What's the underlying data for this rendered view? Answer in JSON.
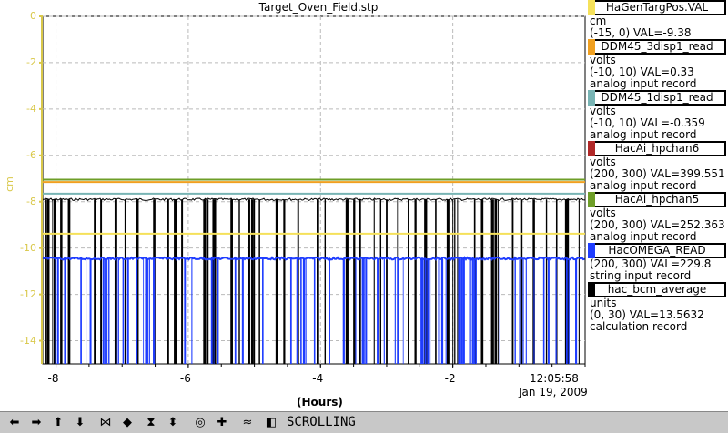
{
  "title": "Target_Oven_Field.stp",
  "axes": {
    "y_label": "cm",
    "y_ticks": [
      "0",
      "-2",
      "-4",
      "-6",
      "-8",
      "-10",
      "-12",
      "-14"
    ],
    "x_ticks": [
      "-8",
      "-6",
      "-4",
      "-2"
    ],
    "x_unit": "(Hours)",
    "time": "12:05:58",
    "date": "Jan 19, 2009"
  },
  "legend": [
    {
      "name": "HaGenTargPos.VAL",
      "color": "#f5e15a",
      "unit": "cm",
      "range_val": "(-15, 0) VAL=-9.38",
      "record": ""
    },
    {
      "name": "DDM45_3disp1_read",
      "color": "#f0a020",
      "unit": "volts",
      "range_val": "(-10, 10) VAL=0.33",
      "record": "analog input record"
    },
    {
      "name": "DDM45_1disp1_read",
      "color": "#78b4b4",
      "unit": "volts",
      "range_val": "(-10, 10) VAL=-0.359",
      "record": "analog input record"
    },
    {
      "name": "HacAi_hpchan6",
      "color": "#b02828",
      "unit": "volts",
      "range_val": "(200, 300) VAL=399.551",
      "record": "analog input record"
    },
    {
      "name": "HacAi_hpchan5",
      "color": "#6e9e28",
      "unit": "volts",
      "range_val": "(200, 300) VAL=252.363",
      "record": "analog input record"
    },
    {
      "name": "HacOMEGA_READ",
      "color": "#1e3cff",
      "unit": "",
      "range_val": "(200, 300) VAL=229.8",
      "record": "string input record"
    },
    {
      "name": "hac_bcm_average",
      "color": "#000000",
      "unit": "units",
      "range_val": "(0, 30) VAL=13.5632",
      "record": "calculation record"
    }
  ],
  "toolbar": {
    "mode_label": "SCROLLING",
    "buttons": [
      "scroll-left-icon",
      "scroll-right-icon",
      "scroll-up-icon",
      "scroll-down-icon",
      "zoom-in-x-icon",
      "zoom-out-x-icon",
      "zoom-in-y-icon",
      "zoom-out-y-icon",
      "autoscale-icon",
      "marker-icon",
      "stagger-icon",
      "export-icon"
    ]
  },
  "chart_data": {
    "type": "line",
    "title": "Target_Oven_Field.stp",
    "xlabel": "(Hours)",
    "ylabel": "cm",
    "xlim": [
      -8.2,
      0
    ],
    "ylim": [
      -15,
      0
    ],
    "grid": true,
    "series": [
      {
        "name": "HacAi_hpchan5",
        "color": "#6e9e28",
        "level": -7.05
      },
      {
        "name": "DDM45_3disp1_read",
        "color": "#f0a020",
        "level": -7.15
      },
      {
        "name": "DDM45_1disp1_read",
        "color": "#78b4b4",
        "level": -7.65
      },
      {
        "name": "hac_bcm_average",
        "color": "#000000",
        "level": -7.9,
        "low": -15
      },
      {
        "name": "HaGenTargPos.VAL",
        "color": "#f5e15a",
        "level": -9.38
      },
      {
        "name": "HacOMEGA_READ",
        "color": "#1e3cff",
        "level": -10.45,
        "low": -15
      }
    ]
  }
}
